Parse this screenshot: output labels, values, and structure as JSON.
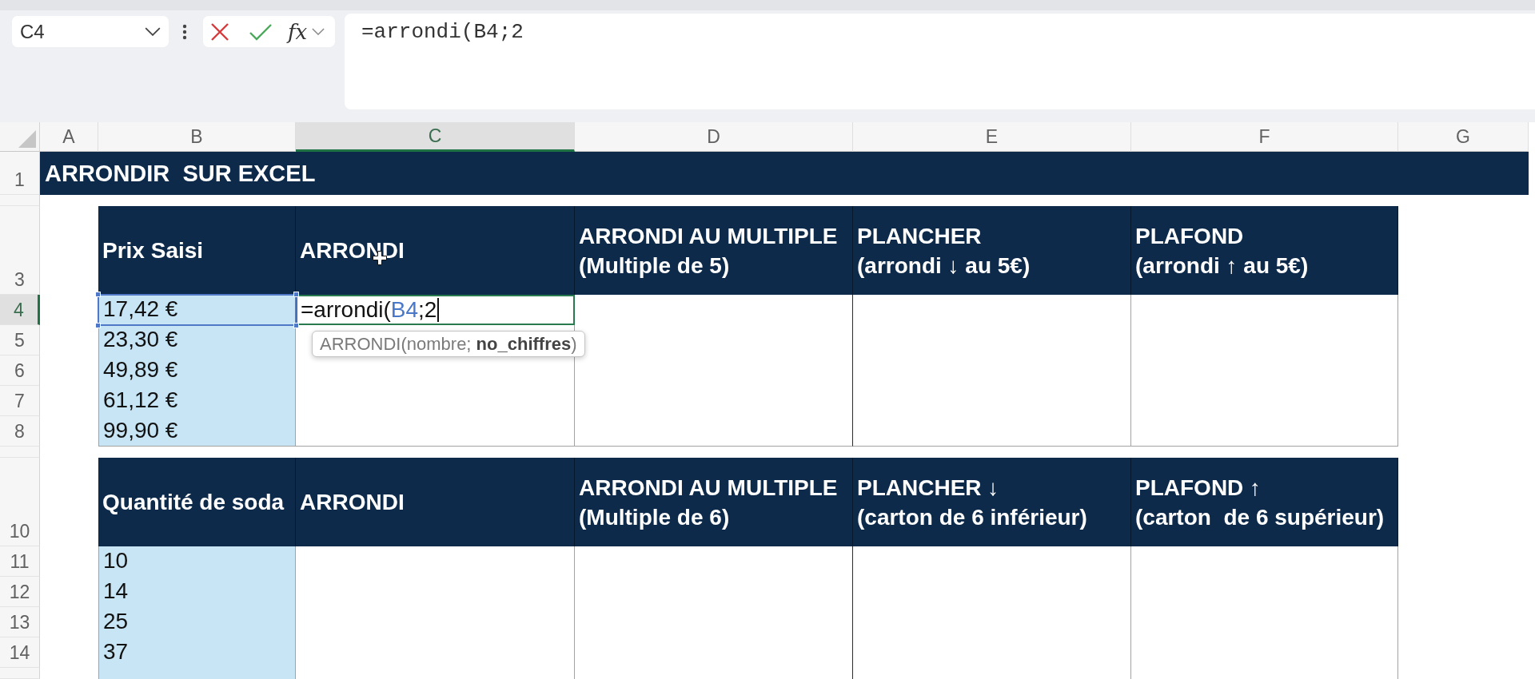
{
  "formula_bar": {
    "name_box": "C4",
    "insert_function": "fx",
    "formula": "=arrondi(B4;2"
  },
  "columns": [
    {
      "label": "A",
      "selected": false
    },
    {
      "label": "B",
      "selected": false
    },
    {
      "label": "C",
      "selected": true
    },
    {
      "label": "D",
      "selected": false
    },
    {
      "label": "E",
      "selected": false
    },
    {
      "label": "F",
      "selected": false
    },
    {
      "label": "G",
      "selected": false
    }
  ],
  "rows": [
    {
      "kind": "title",
      "label": "1",
      "selected": false,
      "title": "ARRONDIR  SUR EXCEL"
    },
    {
      "kind": "spacer",
      "selected": false
    },
    {
      "kind": "header",
      "label": "3",
      "selected": false,
      "headers": [
        "Prix Saisi",
        "ARRONDI",
        "ARRONDI AU MULTIPLE\n(Multiple de 5)",
        "PLANCHER\n(arrondi ↓ au 5€)",
        "PLAFOND\n(arrondi ↑ au 5€)"
      ]
    },
    {
      "kind": "data",
      "label": "4",
      "selected": true,
      "value": "17,42 €",
      "referenced": true,
      "edit": {
        "before": "=arrondi(",
        "reference": "B4",
        "after": ";2",
        "hint": "ARRONDI(nombre; **no_chiffres**)"
      }
    },
    {
      "kind": "data",
      "label": "5",
      "selected": false,
      "value": "23,30 €",
      "referenced": false
    },
    {
      "kind": "data",
      "label": "6",
      "selected": false,
      "value": "49,89 €",
      "referenced": false
    },
    {
      "kind": "data",
      "label": "7",
      "selected": false,
      "value": "61,12 €",
      "referenced": false
    },
    {
      "kind": "data",
      "label": "8",
      "selected": false,
      "value": "99,90 €",
      "referenced": false
    },
    {
      "kind": "spacer",
      "selected": false
    },
    {
      "kind": "header",
      "label": "10",
      "selected": false,
      "headers": [
        "Quantité de soda",
        "ARRONDI",
        "ARRONDI AU MULTIPLE\n(Multiple de 6)",
        "PLANCHER ↓\n(carton de 6 inférieur)",
        "PLAFOND ↑\n(carton  de 6 supérieur)"
      ]
    },
    {
      "kind": "data",
      "label": "11",
      "selected": false,
      "value": "10",
      "referenced": false
    },
    {
      "kind": "data",
      "label": "12",
      "selected": false,
      "value": "14",
      "referenced": false
    },
    {
      "kind": "data",
      "label": "13",
      "selected": false,
      "value": "25",
      "referenced": false
    },
    {
      "kind": "data",
      "label": "14",
      "selected": false,
      "value": "37",
      "referenced": false
    },
    {
      "kind": "data",
      "selected": false,
      "referenced": false
    }
  ]
}
